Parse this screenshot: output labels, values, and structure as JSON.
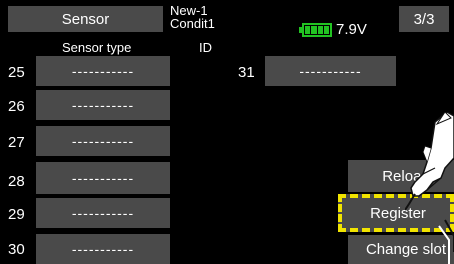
{
  "header": {
    "sensor_tab": "Sensor",
    "model_name": "New-1",
    "condition": "Condit1",
    "voltage": "7.9V",
    "page": "3/3",
    "col_sensor_type": "Sensor type",
    "col_id": "ID"
  },
  "rows": [
    {
      "num": "25",
      "value": "-----------"
    },
    {
      "num": "26",
      "value": "-----------"
    },
    {
      "num": "27",
      "value": "-----------"
    },
    {
      "num": "28",
      "value": "-----------"
    },
    {
      "num": "29",
      "value": "-----------"
    },
    {
      "num": "30",
      "value": "-----------"
    }
  ],
  "row31": {
    "num": "31",
    "value": "-----------"
  },
  "buttons": {
    "reload": "Reload",
    "register": "Register",
    "change_slot": "Change slot"
  },
  "colors": {
    "background": "#000000",
    "cell": "#4a4a4a",
    "highlight": "#f1e400",
    "battery": "#22c322"
  },
  "icons": {
    "battery": "battery-icon",
    "hand": "hand-pointer-icon"
  }
}
